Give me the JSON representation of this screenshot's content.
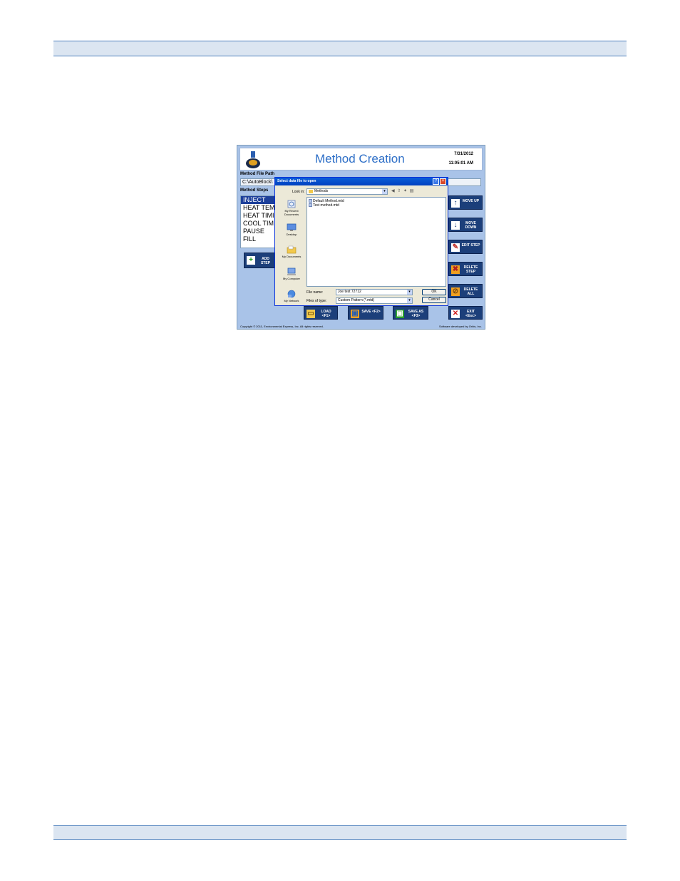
{
  "app": {
    "title": "Method Creation",
    "date": "7/31/2012",
    "time": "11:05:01 AM",
    "method_file_path_label": "Method File Path",
    "method_file_path_value": "C:\\AutoBlock\\",
    "method_steps_label": "Method Steps",
    "steps": [
      "INJECT",
      "HEAT TEM",
      "HEAT TIMI",
      "COOL TIM",
      "PAUSE",
      "FILL"
    ],
    "add_step": "ADD STEP",
    "side_buttons": {
      "move_up": "MOVE UP",
      "move_down": "MOVE DOWN",
      "edit_step": "EDIT STEP",
      "delete_step": "DELETE STEP",
      "delete_all": "DELETE ALL"
    },
    "bottom_buttons": {
      "load": "LOAD <F1>",
      "save": "SAVE <F2>",
      "save_as": "SAVE AS <F3>",
      "exit": "EXIT <Esc>"
    },
    "copyright": "Copyright © 2011, Environmental Express, Inc.  All rights reserved.",
    "credits": "Software developed by Orbis, Inc."
  },
  "dialog": {
    "title": "Select data file to open",
    "look_in_label": "Look in:",
    "look_in_value": "Methods",
    "places": [
      "My Recent Documents",
      "Desktop",
      "My Documents",
      "My Computer",
      "My Network"
    ],
    "files": [
      "Default Method.mtd",
      "Test method.mtd"
    ],
    "file_name_label": "File name:",
    "file_name_value": "Joe test 72712",
    "file_type_label": "Files of type:",
    "file_type_value": "Custom Pattern (*.mtd)",
    "ok": "OK",
    "cancel": "Cancel"
  },
  "colors": {
    "band_fill": "#dbe5f1",
    "band_border": "#4f81bd",
    "app_background": "#a9c3e8",
    "button_navy": "#1c3f7a",
    "title_blue": "#2e6fc7"
  }
}
